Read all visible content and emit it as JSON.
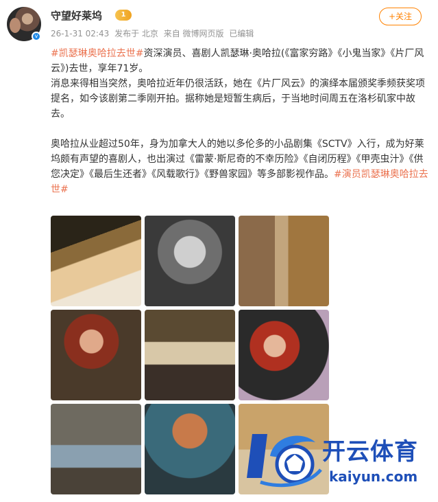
{
  "post": {
    "author": "守望好莱坞",
    "vip_level": "1",
    "verified_mark": "v",
    "timestamp": "26-1-31 02:43",
    "posted_from": "发布于 北京",
    "source": "来自 微博网页版",
    "edited": "已编辑",
    "follow_label": "+关注"
  },
  "content": {
    "p1_tag": "#凯瑟琳奥哈拉去世#",
    "p1_text": "资深演员、喜剧人凯瑟琳·奥哈拉(《富家穷路》《小鬼当家》《片厂风云》)去世，享年71岁。",
    "p2_text": "消息来得相当突然，奥哈拉近年仍很活跃，她在《片厂风云》的演绎本届颁奖季频获奖项提名，如今该剧第二季刚开拍。据称她是短暂生病后，于当地时间周五在洛杉矶家中故去。",
    "p3_text": "奥哈拉从业超过50年，身为加拿大人的她以多伦多的小品剧集《SCTV》入行，成为好莱坞颇有声望的喜剧人，也出演过《雷蒙·斯尼奇的不幸历险》《自闭历程》《甲壳虫汁》《供您决定》《最后生还者》《风载歌行》《野兽家园》等多部影视作品。",
    "p3_tag": "#演员凯瑟琳奥哈拉去世#"
  },
  "watermark": {
    "brand": "开云体育",
    "url": "kaiyun.com"
  }
}
